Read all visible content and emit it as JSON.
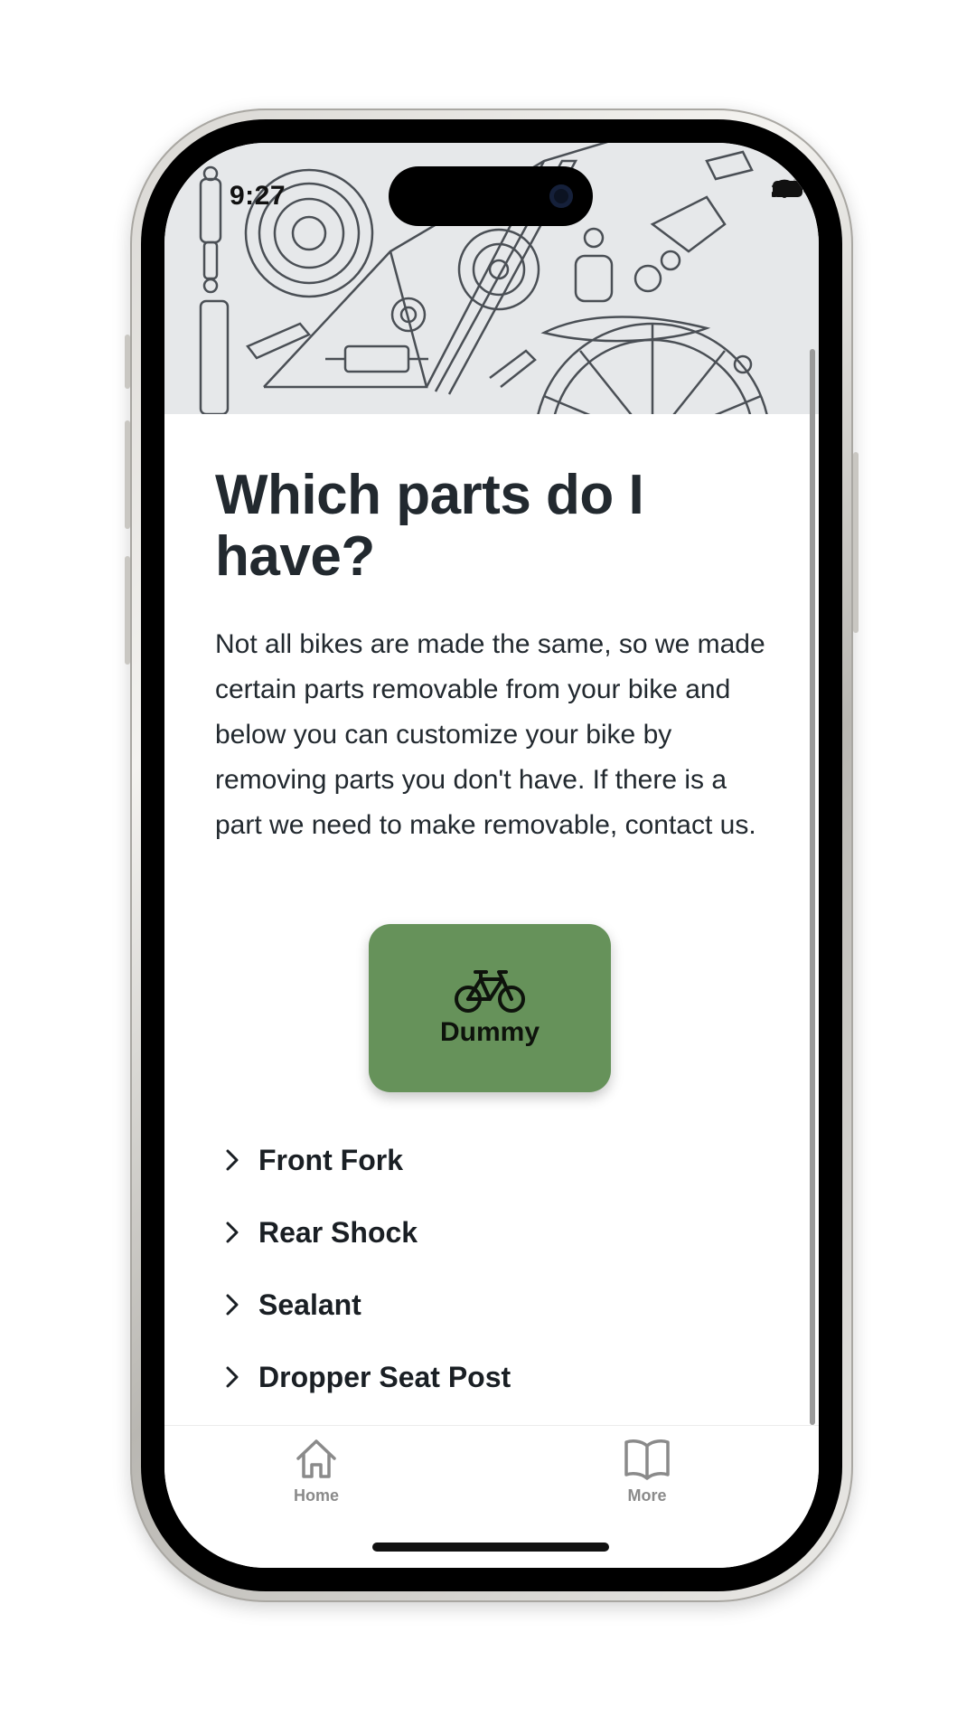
{
  "status_bar": {
    "time": "9:27"
  },
  "page": {
    "title": "Which parts do I have?",
    "description": "Not all bikes are made the same, so we made certain parts removable from your bike and below you can customize your bike by removing parts you don't have. If there is a part we need to make removable, contact us."
  },
  "preset_card": {
    "label": "Dummy",
    "icon": "bicycle-icon",
    "color": "#66925a"
  },
  "parts": [
    {
      "label": "Front Fork"
    },
    {
      "label": "Rear Shock"
    },
    {
      "label": "Sealant"
    },
    {
      "label": "Dropper Seat Post"
    }
  ],
  "tab_bar": {
    "tabs": [
      {
        "label": "Home",
        "icon": "house-icon"
      },
      {
        "label": "More",
        "icon": "book-icon"
      }
    ]
  }
}
